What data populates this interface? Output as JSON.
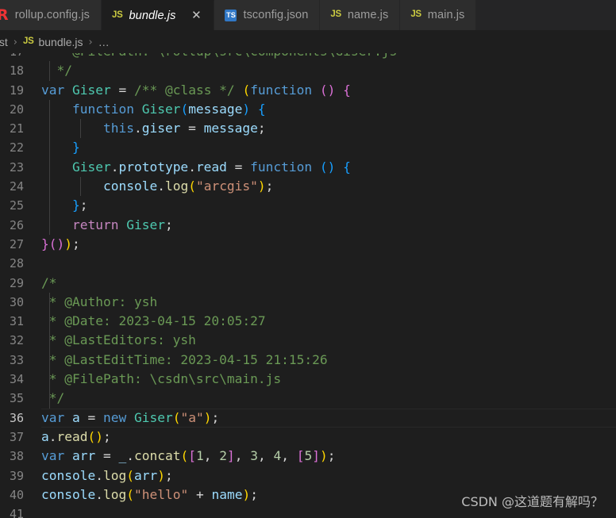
{
  "tabs": [
    {
      "label": "rollup.config.js",
      "icon": "rollup-file-icon",
      "icon_text": "R",
      "active": false,
      "closable": false
    },
    {
      "label": "bundle.js",
      "icon": "js-file-icon",
      "icon_text": "JS",
      "active": true,
      "closable": true,
      "close_glyph": "✕"
    },
    {
      "label": "tsconfig.json",
      "icon": "ts-file-icon",
      "icon_text": "TS",
      "active": false,
      "closable": false
    },
    {
      "label": "name.js",
      "icon": "js-file-icon",
      "icon_text": "JS",
      "active": false,
      "closable": false
    },
    {
      "label": "main.js",
      "icon": "js-file-icon",
      "icon_text": "JS",
      "active": false,
      "closable": false
    }
  ],
  "breadcrumb": {
    "separator": "›",
    "items": [
      {
        "label": "dist",
        "icon_text": ""
      },
      {
        "label": "bundle.js",
        "icon_text": "JS"
      },
      {
        "label": "…",
        "icon_text": ""
      }
    ]
  },
  "editor": {
    "language": "JavaScript",
    "current_line": 36,
    "first_visible_line": 17,
    "last_visible_line": 41,
    "lines": [
      {
        "n": 17,
        "clipped": true,
        "tokens": [
          {
            "t": "    @FilePath: \\rollup\\src\\components\\Giser.js",
            "c": "t-cmt"
          }
        ]
      },
      {
        "n": 18,
        "tokens": [
          {
            "t": "  ",
            "c": "t-plain"
          },
          {
            "t": "*/",
            "c": "t-cmt"
          }
        ]
      },
      {
        "n": 19,
        "tokens": [
          {
            "t": "var",
            "c": "t-kw"
          },
          {
            "t": " ",
            "c": "t-plain"
          },
          {
            "t": "Giser",
            "c": "t-type"
          },
          {
            "t": " = ",
            "c": "t-op"
          },
          {
            "t": "/** @class */",
            "c": "t-cmt"
          },
          {
            "t": " ",
            "c": "t-plain"
          },
          {
            "t": "(",
            "c": "t-p1"
          },
          {
            "t": "function",
            "c": "t-kw"
          },
          {
            "t": " ",
            "c": "t-plain"
          },
          {
            "t": "(",
            "c": "t-p2"
          },
          {
            "t": ")",
            "c": "t-p2"
          },
          {
            "t": " ",
            "c": "t-plain"
          },
          {
            "t": "{",
            "c": "t-p2"
          }
        ]
      },
      {
        "n": 20,
        "tokens": [
          {
            "t": "    ",
            "c": "t-plain"
          },
          {
            "t": "function",
            "c": "t-kw"
          },
          {
            "t": " ",
            "c": "t-plain"
          },
          {
            "t": "Giser",
            "c": "t-type"
          },
          {
            "t": "(",
            "c": "t-p3"
          },
          {
            "t": "message",
            "c": "t-var"
          },
          {
            "t": ")",
            "c": "t-p3"
          },
          {
            "t": " ",
            "c": "t-plain"
          },
          {
            "t": "{",
            "c": "t-p3"
          }
        ]
      },
      {
        "n": 21,
        "tokens": [
          {
            "t": "        ",
            "c": "t-plain"
          },
          {
            "t": "this",
            "c": "t-kw"
          },
          {
            "t": ".",
            "c": "t-plain"
          },
          {
            "t": "giser",
            "c": "t-var"
          },
          {
            "t": " = ",
            "c": "t-op"
          },
          {
            "t": "message",
            "c": "t-var"
          },
          {
            "t": ";",
            "c": "t-plain"
          }
        ]
      },
      {
        "n": 22,
        "tokens": [
          {
            "t": "    ",
            "c": "t-plain"
          },
          {
            "t": "}",
            "c": "t-p3"
          }
        ]
      },
      {
        "n": 23,
        "tokens": [
          {
            "t": "    ",
            "c": "t-plain"
          },
          {
            "t": "Giser",
            "c": "t-type"
          },
          {
            "t": ".",
            "c": "t-plain"
          },
          {
            "t": "prototype",
            "c": "t-var"
          },
          {
            "t": ".",
            "c": "t-plain"
          },
          {
            "t": "read",
            "c": "t-var"
          },
          {
            "t": " = ",
            "c": "t-op"
          },
          {
            "t": "function",
            "c": "t-kw"
          },
          {
            "t": " ",
            "c": "t-plain"
          },
          {
            "t": "(",
            "c": "t-p3"
          },
          {
            "t": ")",
            "c": "t-p3"
          },
          {
            "t": " ",
            "c": "t-plain"
          },
          {
            "t": "{",
            "c": "t-p3"
          }
        ]
      },
      {
        "n": 24,
        "tokens": [
          {
            "t": "        ",
            "c": "t-plain"
          },
          {
            "t": "console",
            "c": "t-var"
          },
          {
            "t": ".",
            "c": "t-plain"
          },
          {
            "t": "log",
            "c": "t-fn"
          },
          {
            "t": "(",
            "c": "t-p1"
          },
          {
            "t": "\"arcgis\"",
            "c": "t-str"
          },
          {
            "t": ")",
            "c": "t-p1"
          },
          {
            "t": ";",
            "c": "t-plain"
          }
        ]
      },
      {
        "n": 25,
        "tokens": [
          {
            "t": "    ",
            "c": "t-plain"
          },
          {
            "t": "}",
            "c": "t-p3"
          },
          {
            "t": ";",
            "c": "t-plain"
          }
        ]
      },
      {
        "n": 26,
        "tokens": [
          {
            "t": "    ",
            "c": "t-plain"
          },
          {
            "t": "return",
            "c": "t-ctrl"
          },
          {
            "t": " ",
            "c": "t-plain"
          },
          {
            "t": "Giser",
            "c": "t-type"
          },
          {
            "t": ";",
            "c": "t-plain"
          }
        ]
      },
      {
        "n": 27,
        "tokens": [
          {
            "t": "}",
            "c": "t-p2"
          },
          {
            "t": "(",
            "c": "t-p2"
          },
          {
            "t": ")",
            "c": "t-p2"
          },
          {
            "t": ")",
            "c": "t-p1"
          },
          {
            "t": ";",
            "c": "t-plain"
          }
        ]
      },
      {
        "n": 28,
        "tokens": []
      },
      {
        "n": 29,
        "tokens": [
          {
            "t": "/*",
            "c": "t-cmt"
          }
        ]
      },
      {
        "n": 30,
        "tokens": [
          {
            "t": " * @Author: ysh",
            "c": "t-cmt"
          }
        ]
      },
      {
        "n": 31,
        "tokens": [
          {
            "t": " * @Date: 2023-04-15 20:05:27",
            "c": "t-cmt"
          }
        ]
      },
      {
        "n": 32,
        "tokens": [
          {
            "t": " * @LastEditors: ysh",
            "c": "t-cmt"
          }
        ]
      },
      {
        "n": 33,
        "tokens": [
          {
            "t": " * @LastEditTime: 2023-04-15 21:15:26",
            "c": "t-cmt"
          }
        ]
      },
      {
        "n": 34,
        "tokens": [
          {
            "t": " * @FilePath: \\csdn\\src\\main.js",
            "c": "t-cmt"
          }
        ]
      },
      {
        "n": 35,
        "tokens": [
          {
            "t": " */",
            "c": "t-cmt"
          }
        ]
      },
      {
        "n": 36,
        "current": true,
        "tokens": [
          {
            "t": "var",
            "c": "t-kw"
          },
          {
            "t": " ",
            "c": "t-plain"
          },
          {
            "t": "a",
            "c": "t-var"
          },
          {
            "t": " = ",
            "c": "t-op"
          },
          {
            "t": "new",
            "c": "t-kw"
          },
          {
            "t": " ",
            "c": "t-plain"
          },
          {
            "t": "Giser",
            "c": "t-type"
          },
          {
            "t": "(",
            "c": "t-p1"
          },
          {
            "t": "\"a\"",
            "c": "t-str"
          },
          {
            "t": ")",
            "c": "t-p1"
          },
          {
            "t": ";",
            "c": "t-plain"
          }
        ]
      },
      {
        "n": 37,
        "tokens": [
          {
            "t": "a",
            "c": "t-var"
          },
          {
            "t": ".",
            "c": "t-plain"
          },
          {
            "t": "read",
            "c": "t-fn"
          },
          {
            "t": "(",
            "c": "t-p1"
          },
          {
            "t": ")",
            "c": "t-p1"
          },
          {
            "t": ";",
            "c": "t-plain"
          }
        ]
      },
      {
        "n": 38,
        "tokens": [
          {
            "t": "var",
            "c": "t-kw"
          },
          {
            "t": " ",
            "c": "t-plain"
          },
          {
            "t": "arr",
            "c": "t-var"
          },
          {
            "t": " = ",
            "c": "t-op"
          },
          {
            "t": "_",
            "c": "t-var"
          },
          {
            "t": ".",
            "c": "t-plain"
          },
          {
            "t": "concat",
            "c": "t-fn"
          },
          {
            "t": "(",
            "c": "t-p1"
          },
          {
            "t": "[",
            "c": "t-p2"
          },
          {
            "t": "1",
            "c": "t-num"
          },
          {
            "t": ", ",
            "c": "t-plain"
          },
          {
            "t": "2",
            "c": "t-num"
          },
          {
            "t": "]",
            "c": "t-p2"
          },
          {
            "t": ", ",
            "c": "t-plain"
          },
          {
            "t": "3",
            "c": "t-num"
          },
          {
            "t": ", ",
            "c": "t-plain"
          },
          {
            "t": "4",
            "c": "t-num"
          },
          {
            "t": ", ",
            "c": "t-plain"
          },
          {
            "t": "[",
            "c": "t-p2"
          },
          {
            "t": "5",
            "c": "t-num"
          },
          {
            "t": "]",
            "c": "t-p2"
          },
          {
            "t": ")",
            "c": "t-p1"
          },
          {
            "t": ";",
            "c": "t-plain"
          }
        ]
      },
      {
        "n": 39,
        "tokens": [
          {
            "t": "console",
            "c": "t-var"
          },
          {
            "t": ".",
            "c": "t-plain"
          },
          {
            "t": "log",
            "c": "t-fn"
          },
          {
            "t": "(",
            "c": "t-p1"
          },
          {
            "t": "arr",
            "c": "t-var"
          },
          {
            "t": ")",
            "c": "t-p1"
          },
          {
            "t": ";",
            "c": "t-plain"
          }
        ]
      },
      {
        "n": 40,
        "tokens": [
          {
            "t": "console",
            "c": "t-var"
          },
          {
            "t": ".",
            "c": "t-plain"
          },
          {
            "t": "log",
            "c": "t-fn"
          },
          {
            "t": "(",
            "c": "t-p1"
          },
          {
            "t": "\"hello\"",
            "c": "t-str"
          },
          {
            "t": " + ",
            "c": "t-op"
          },
          {
            "t": "name",
            "c": "t-var"
          },
          {
            "t": ")",
            "c": "t-p1"
          },
          {
            "t": ";",
            "c": "t-plain"
          }
        ]
      },
      {
        "n": 41,
        "tokens": []
      }
    ]
  },
  "watermark": {
    "text": "CSDN @这道题有解吗？"
  },
  "colors": {
    "editor_background": "#1e1e1e",
    "tabbar_background": "#252526",
    "inactive_tab_background": "#2d2d2d",
    "active_tab_foreground": "#ffffff",
    "inactive_tab_foreground": "#9d9d9d",
    "line_number": "#858585",
    "active_line_number": "#c6c6c6",
    "keyword": "#569cd6",
    "control_keyword": "#c586c0",
    "type": "#4ec9b0",
    "function": "#dcdcaa",
    "variable": "#9cdcfe",
    "string": "#ce9178",
    "number": "#b5cea8",
    "comment": "#6a9955",
    "bracket_1": "#ffd700",
    "bracket_2": "#da70d6",
    "bracket_3": "#179fff",
    "js_icon": "#cbcb41",
    "ts_icon": "#3178c6",
    "rollup_icon": "#ef3335"
  }
}
